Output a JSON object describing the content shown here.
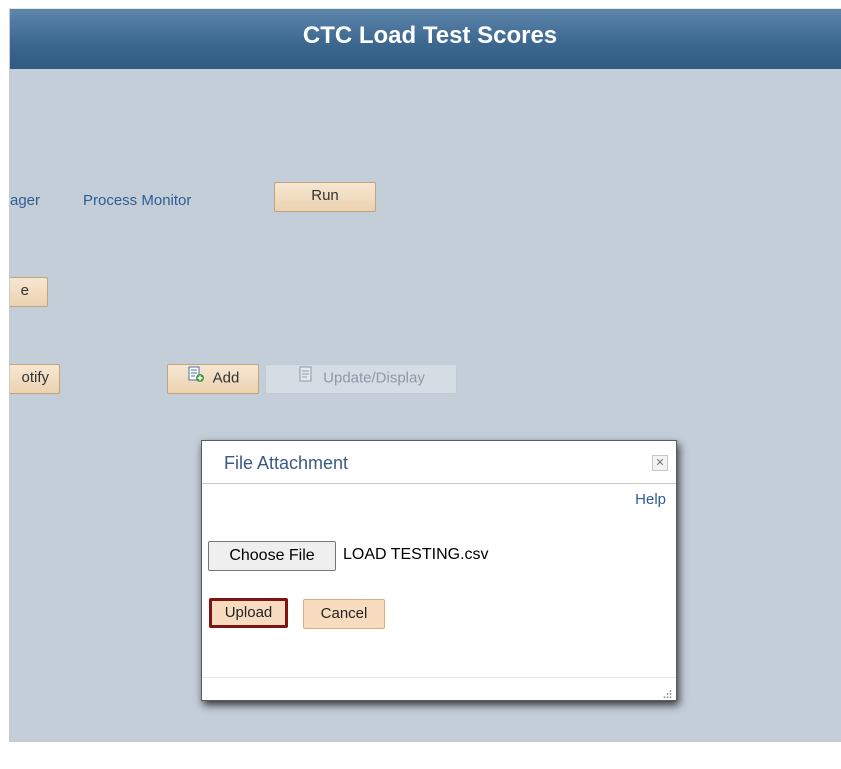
{
  "page": {
    "title": "CTC Load Test Scores"
  },
  "links": {
    "process_scheduler_partial": "ager",
    "process_monitor": "Process Monitor"
  },
  "buttons": {
    "run": "Run",
    "partial_button_1": "e",
    "partial_button_2": "otify",
    "add": "Add",
    "update_display": "Update/Display"
  },
  "dialog": {
    "title": "File Attachment",
    "help": "Help",
    "choose_file": "Choose File",
    "file_name": "LOAD TESTING.csv",
    "upload": "Upload",
    "cancel": "Cancel",
    "close_glyph": "✕"
  },
  "icons": {
    "add": "add-document-icon",
    "update": "update-document-icon",
    "close": "close-icon",
    "resize": "resize-grip-icon"
  }
}
